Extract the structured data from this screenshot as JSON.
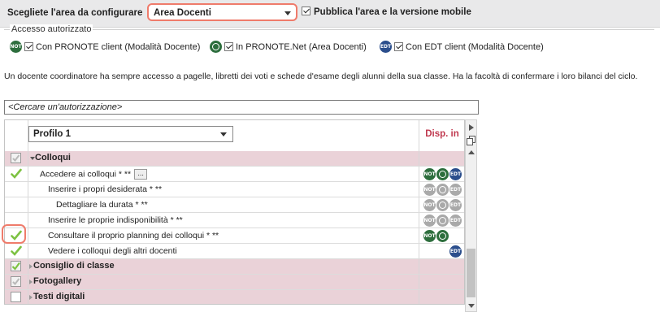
{
  "top": {
    "area_label": "Scegliete l'area da configurare",
    "area_value": "Area Docenti",
    "publish_label": "Pubblica l'area e la versione mobile",
    "publish_checked": true
  },
  "access": {
    "legend": "Accesso autorizzato",
    "items": [
      {
        "badge": "NOT",
        "label": "Con PRONOTE client (Modalità Docente)",
        "checked": true
      },
      {
        "badge": "",
        "label": "In PRONOTE.Net (Area Docenti)",
        "checked": true
      },
      {
        "badge": "EDT",
        "label": "Con EDT client (Modalità Docente)",
        "checked": true
      }
    ]
  },
  "description": "Un docente coordinatore ha sempre accesso a pagelle, libretti dei voti e schede d'esame degli alunni della sua classe. Ha la facoltà di confermare i loro bilanci del ciclo.",
  "search": {
    "placeholder": "<Cercare un'autorizzazione>"
  },
  "table": {
    "profile_value": "Profilo 1",
    "disp_header": "Disp. in",
    "more_label": "...",
    "rows": [
      {
        "label": "Colloqui",
        "type": "category",
        "expanded": true,
        "state": "partial"
      },
      {
        "label": "Accedere ai colloqui * **",
        "type": "item",
        "checked": true,
        "disp": [
          "NOT",
          "NET",
          "EDT"
        ]
      },
      {
        "label": "Inserire i propri desiderata * **",
        "type": "item",
        "checked": false,
        "disp": [
          "NOT-gray",
          "NET-gray",
          "EDT-gray"
        ]
      },
      {
        "label": "Dettagliare la durata * **",
        "type": "item",
        "checked": false,
        "disp": [
          "NOT-gray",
          "NET-gray",
          "EDT-gray"
        ]
      },
      {
        "label": "Inserire le proprie indisponibilità * **",
        "type": "item",
        "checked": false,
        "disp": [
          "NOT-gray",
          "NET-gray",
          "EDT-gray"
        ]
      },
      {
        "label": "Consultare il proprio planning dei colloqui * **",
        "type": "item",
        "checked": true,
        "disp": [
          "NOT",
          "NET"
        ]
      },
      {
        "label": "Vedere i colloqui degli altri docenti",
        "type": "item",
        "checked": true,
        "disp": [
          "EDT"
        ]
      },
      {
        "label": "Consiglio di classe",
        "type": "category",
        "expanded": false,
        "state": "checked"
      },
      {
        "label": "Fotogallery",
        "type": "category",
        "expanded": false,
        "state": "partial"
      },
      {
        "label": "Testi digitali",
        "type": "category",
        "expanded": false,
        "state": "unchecked"
      }
    ]
  },
  "colors": {
    "highlight": "#ef7b6b",
    "category_bg": "#ead2d8",
    "disp_header": "#c0394f",
    "check_green": "#7dc242"
  }
}
